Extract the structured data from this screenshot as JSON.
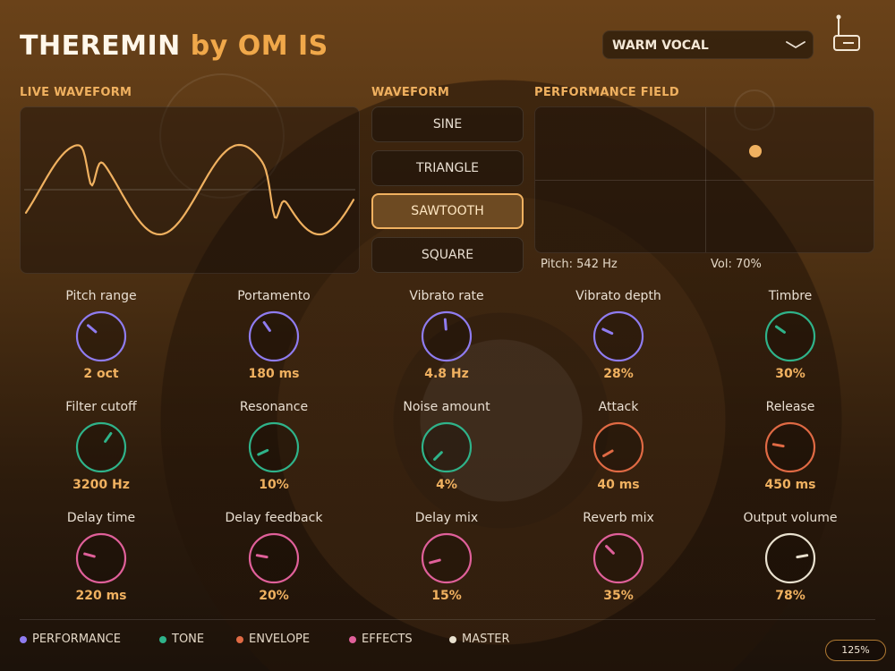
{
  "app": {
    "title_main": "THEREMIN",
    "title_sub": "by OM IS"
  },
  "preset": {
    "selected": "WARM VOCAL"
  },
  "sections": {
    "live_waveform": "LIVE WAVEFORM",
    "waveform": "WAVEFORM",
    "performance_field": "PERFORMANCE FIELD"
  },
  "waveform_options": [
    {
      "label": "SINE",
      "selected": false
    },
    {
      "label": "TRIANGLE",
      "selected": false
    },
    {
      "label": "SAWTOOTH",
      "selected": true
    },
    {
      "label": "SQUARE",
      "selected": false
    }
  ],
  "performance": {
    "pitch_readout": "Pitch: 542 Hz",
    "volume_readout": "Vol: 70%",
    "pitch_fraction": 0.65,
    "volume_fraction": 0.7
  },
  "colors": {
    "performance": "#8f7cf0",
    "tone": "#2fb38a",
    "envelope": "#e06a44",
    "effects": "#e0609a",
    "master": "#e9e1cf",
    "accent": "#f0b160"
  },
  "knobs": [
    {
      "label": "Pitch range",
      "value": "2 oct",
      "group": "performance",
      "angle": -50
    },
    {
      "label": "Portamento",
      "value": "180 ms",
      "group": "performance",
      "angle": -35
    },
    {
      "label": "Vibrato rate",
      "value": "4.8 Hz",
      "group": "performance",
      "angle": -5
    },
    {
      "label": "Vibrato depth",
      "value": "28%",
      "group": "performance",
      "angle": -65
    },
    {
      "label": "Timbre",
      "value": "30%",
      "group": "tone",
      "angle": -55
    },
    {
      "label": "Filter cutoff",
      "value": "3200 Hz",
      "group": "tone",
      "angle": 35
    },
    {
      "label": "Resonance",
      "value": "10%",
      "group": "tone",
      "angle": -115
    },
    {
      "label": "Noise amount",
      "value": "4%",
      "group": "tone",
      "angle": -135
    },
    {
      "label": "Attack",
      "value": "40 ms",
      "group": "envelope",
      "angle": -120
    },
    {
      "label": "Release",
      "value": "450 ms",
      "group": "envelope",
      "angle": -80
    },
    {
      "label": "Delay time",
      "value": "220 ms",
      "group": "effects",
      "angle": -75
    },
    {
      "label": "Delay feedback",
      "value": "20%",
      "group": "effects",
      "angle": -80
    },
    {
      "label": "Delay mix",
      "value": "15%",
      "group": "effects",
      "angle": -105
    },
    {
      "label": "Reverb mix",
      "value": "35%",
      "group": "effects",
      "angle": -45
    },
    {
      "label": "Output volume",
      "value": "78%",
      "group": "master",
      "angle": 80
    }
  ],
  "legend": [
    {
      "label": "PERFORMANCE",
      "group": "performance"
    },
    {
      "label": "TONE",
      "group": "tone"
    },
    {
      "label": "ENVELOPE",
      "group": "envelope"
    },
    {
      "label": "EFFECTS",
      "group": "effects"
    },
    {
      "label": "MASTER",
      "group": "master"
    }
  ],
  "zoom": "125%"
}
